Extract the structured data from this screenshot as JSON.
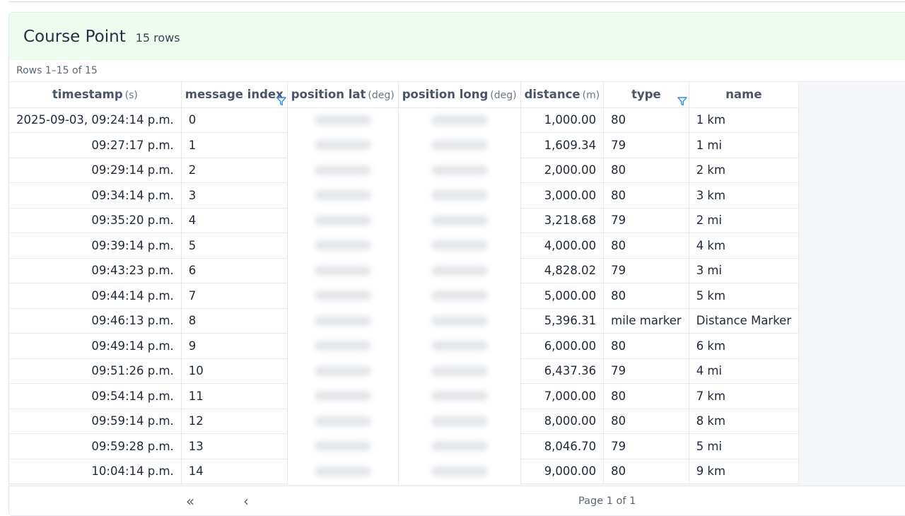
{
  "card": {
    "title": "Course Point",
    "row_count": "15 rows",
    "range_text": "Rows 1–15 of 15"
  },
  "columns": [
    {
      "label": "timestamp",
      "unit": "(s)"
    },
    {
      "label": "message index",
      "unit": ""
    },
    {
      "label": "position lat",
      "unit": "(deg)"
    },
    {
      "label": "position long",
      "unit": "(deg)"
    },
    {
      "label": "distance",
      "unit": "(m)"
    },
    {
      "label": "type",
      "unit": ""
    },
    {
      "label": "name",
      "unit": ""
    }
  ],
  "rows": [
    {
      "timestamp": "2025-09-03, 09:24:14 p.m.",
      "message_index": "0",
      "distance": "1,000.00",
      "type": "80",
      "name": "1 km"
    },
    {
      "timestamp": "09:27:17 p.m.",
      "message_index": "1",
      "distance": "1,609.34",
      "type": "79",
      "name": "1 mi"
    },
    {
      "timestamp": "09:29:14 p.m.",
      "message_index": "2",
      "distance": "2,000.00",
      "type": "80",
      "name": "2 km"
    },
    {
      "timestamp": "09:34:14 p.m.",
      "message_index": "3",
      "distance": "3,000.00",
      "type": "80",
      "name": "3 km"
    },
    {
      "timestamp": "09:35:20 p.m.",
      "message_index": "4",
      "distance": "3,218.68",
      "type": "79",
      "name": "2 mi"
    },
    {
      "timestamp": "09:39:14 p.m.",
      "message_index": "5",
      "distance": "4,000.00",
      "type": "80",
      "name": "4 km"
    },
    {
      "timestamp": "09:43:23 p.m.",
      "message_index": "6",
      "distance": "4,828.02",
      "type": "79",
      "name": "3 mi"
    },
    {
      "timestamp": "09:44:14 p.m.",
      "message_index": "7",
      "distance": "5,000.00",
      "type": "80",
      "name": "5 km"
    },
    {
      "timestamp": "09:46:13 p.m.",
      "message_index": "8",
      "distance": "5,396.31",
      "type": "mile marker",
      "name": "Distance Marker"
    },
    {
      "timestamp": "09:49:14 p.m.",
      "message_index": "9",
      "distance": "6,000.00",
      "type": "80",
      "name": "6 km"
    },
    {
      "timestamp": "09:51:26 p.m.",
      "message_index": "10",
      "distance": "6,437.36",
      "type": "79",
      "name": "4 mi"
    },
    {
      "timestamp": "09:54:14 p.m.",
      "message_index": "11",
      "distance": "7,000.00",
      "type": "80",
      "name": "7 km"
    },
    {
      "timestamp": "09:59:14 p.m.",
      "message_index": "12",
      "distance": "8,000.00",
      "type": "80",
      "name": "8 km"
    },
    {
      "timestamp": "09:59:28 p.m.",
      "message_index": "13",
      "distance": "8,046.70",
      "type": "79",
      "name": "5 mi"
    },
    {
      "timestamp": "10:04:14 p.m.",
      "message_index": "14",
      "distance": "9,000.00",
      "type": "80",
      "name": "9 km"
    }
  ],
  "pagination": {
    "first_icon": "double-chevron-left-icon",
    "prev_icon": "chevron-left-icon",
    "first_glyph": "«",
    "prev_glyph": "‹",
    "page_text": "Page 1 of 1"
  },
  "colors": {
    "header_bg": "#eefcf0",
    "filter_icon": "#2f8be6"
  }
}
